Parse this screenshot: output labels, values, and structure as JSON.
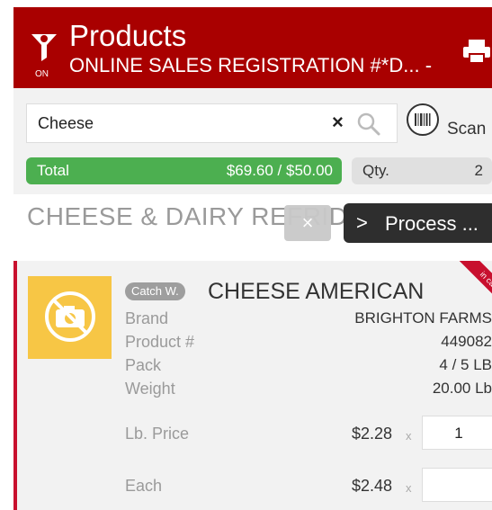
{
  "header": {
    "title": "Products",
    "subtitle": "ONLINE SALES REGISTRATION #*D... -",
    "filter_state": "ON",
    "filter_icon": "filter-icon",
    "print_icon": "printer-icon",
    "background_color": "#a90000"
  },
  "search": {
    "value": "Cheese",
    "clear_label": "×",
    "search_icon": "search-icon",
    "scan_icon": "barcode-icon",
    "scan_label": "Scan"
  },
  "totals": {
    "total_label": "Total",
    "total_value": "$69.60 / $50.00",
    "qty_label": "Qty.",
    "qty_value": "2",
    "total_color": "#4caf50"
  },
  "category": {
    "title": "CHEESE & DAIRY REFRIDGE",
    "dismiss_label": "×",
    "process_chevron": ">",
    "process_label": "Process ..."
  },
  "product": {
    "banner_text": "in cart",
    "badge": "Catch W.",
    "name": "CHEESE AMERICAN",
    "image_placeholder_icon": "no-photo-icon",
    "fields": [
      {
        "label": "Brand",
        "value": "BRIGHTON FARMS"
      },
      {
        "label": "Product #",
        "value": "449082"
      },
      {
        "label": "Pack",
        "value": "4 / 5 LB"
      },
      {
        "label": "Weight",
        "value": "20.00 Lb"
      }
    ],
    "prices": [
      {
        "label": "Lb. Price",
        "price": "$2.28",
        "x": "x",
        "qty": "1"
      },
      {
        "label": "Each",
        "price": "$2.48",
        "x": "x",
        "qty": ""
      }
    ],
    "accent_color": "#c8102e"
  }
}
